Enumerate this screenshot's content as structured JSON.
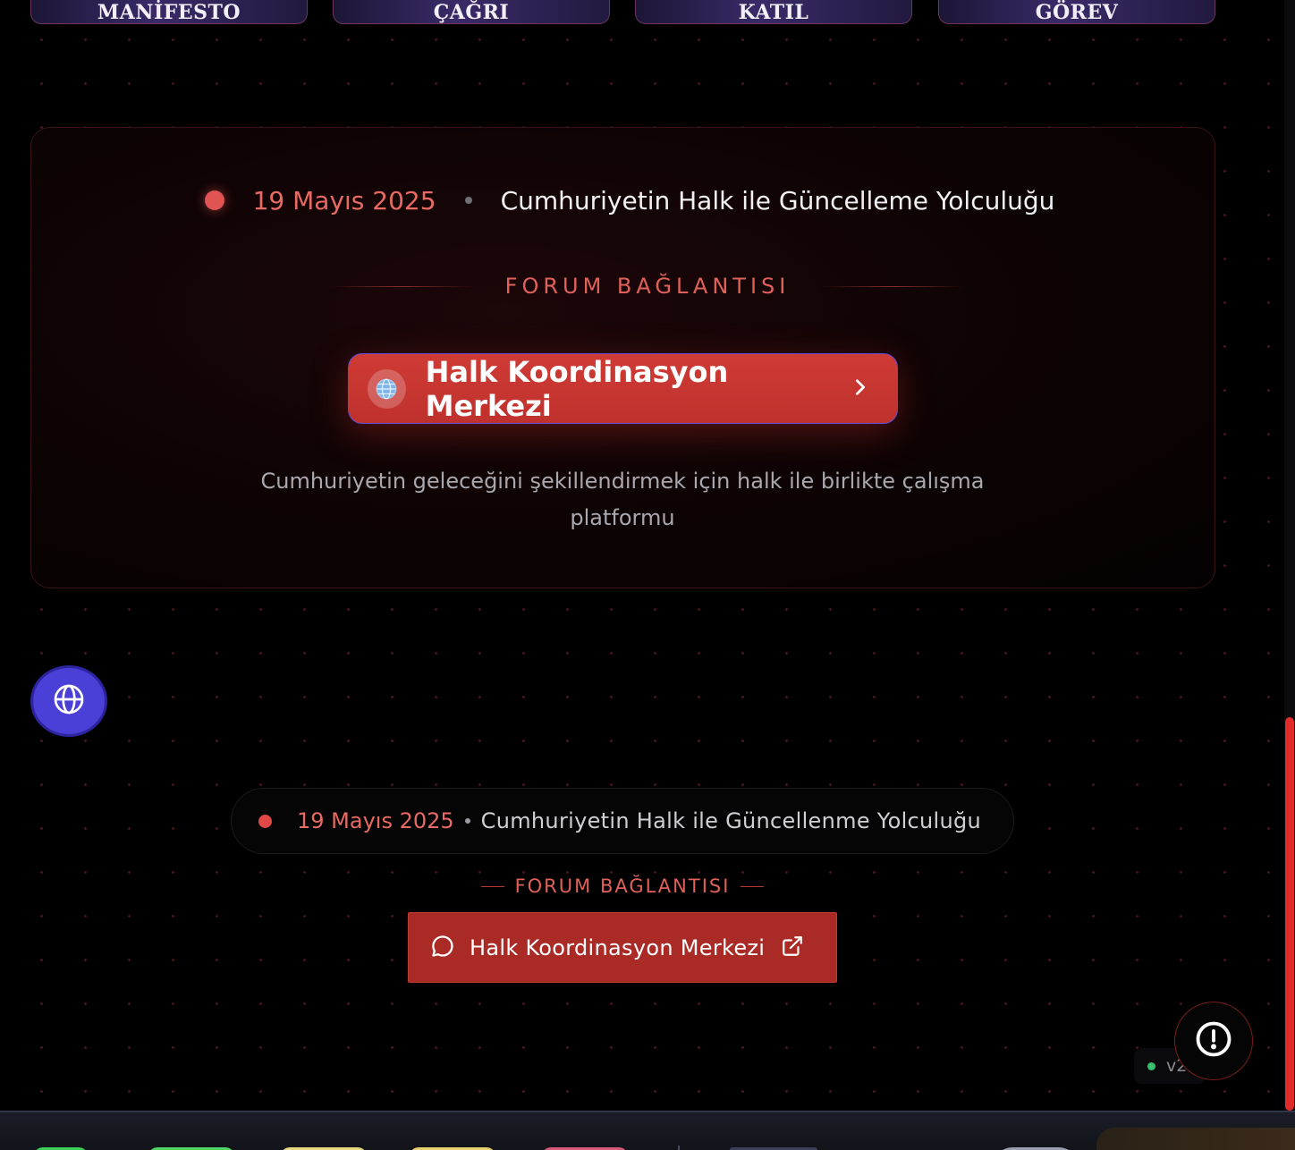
{
  "nav": {
    "items": [
      "MANİFESTO",
      "ÇAĞRI",
      "KATIL",
      "GÖREV"
    ]
  },
  "hero": {
    "date": "19 Mayıs 2025",
    "title": "Cumhuriyetin Halk ile Güncelleme Yolculuğu",
    "section_label": "FORUM BAĞLANTISI",
    "cta_label": "Halk Koordinasyon Merkezi",
    "description": "Cumhuriyetin geleceğini şekillendirmek için halk ile birlikte çalışma platformu"
  },
  "footer": {
    "date": "19 Mayıs 2025",
    "title": "Cumhuriyetin Halk ile Güncellenme Yolculuğu",
    "section_label": "FORUM BAĞLANTISI",
    "cta_label": "Halk Koordinasyon Merkezi"
  },
  "version": "v2.1",
  "icons": {
    "language": "globe-icon",
    "cta_big_left": "globe-icon",
    "cta_big_right": "chevron-right-icon",
    "cta_small_left": "chat-icon",
    "cta_small_right": "external-link-icon",
    "alert": "alert-icon"
  },
  "colors": {
    "accent_red": "#e05454",
    "cta_red": "#c9362f",
    "language_button": "#4a3fd6",
    "status_green": "#38c16a",
    "scrollbar": "#e12a2a"
  }
}
